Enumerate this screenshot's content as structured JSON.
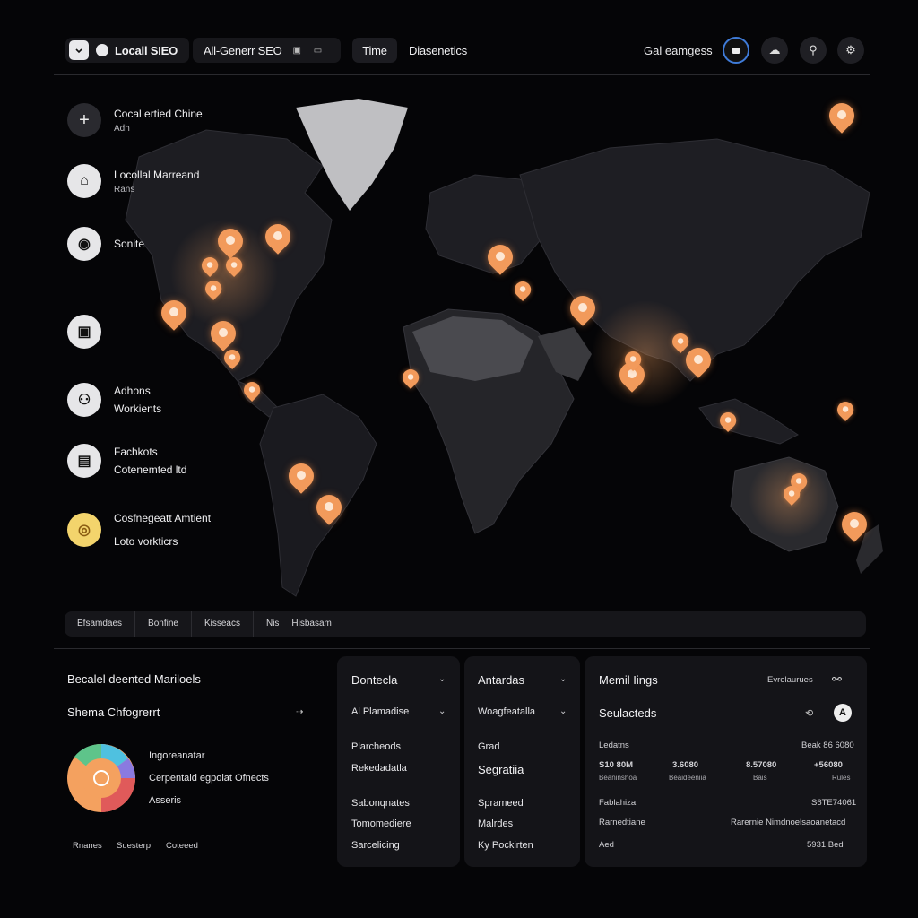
{
  "header": {
    "app_title": "Locall SIEO",
    "tab_seo": "All-Generr SEO",
    "tab_time": "Time",
    "tab_diagnostics": "Diasenetics",
    "user_label": "Gal eamgess"
  },
  "sidebar": {
    "items": [
      {
        "title": "Cocal ertied Chine",
        "sub": "Adh"
      },
      {
        "title": "Locollal Marreand",
        "sub": "Rans"
      },
      {
        "title": "Sonite",
        "sub": ""
      },
      {
        "title": "",
        "sub": ""
      },
      {
        "title": "Adhons",
        "sub": "Workients"
      },
      {
        "title": "Fachkots",
        "sub": "Cotenemted ltd"
      },
      {
        "title": "Cosfnegeatt Amtient",
        "sub": "Loto vorkticrs"
      }
    ]
  },
  "filter_strip": [
    "Efsamdaes",
    "Bonfine",
    "Kisseacs",
    "Nis",
    "Hisbasam"
  ],
  "panel_left": {
    "title": "Becalel deented Mariloels",
    "subtitle": "Shema Chfogrerrt",
    "legend": [
      "Ingoreanatar",
      "Cerpentald egpolat Ofnects",
      "Asseris"
    ],
    "footer": [
      "Rnanes",
      "Suesterp",
      "Coteeed"
    ],
    "donut_colors": [
      "#f4a15f",
      "#e05a5a",
      "#4fc1e0",
      "#5ec48a",
      "#8a7ae0"
    ]
  },
  "panel_mid1": {
    "title": "Dontecla",
    "select": "Al Plamadise",
    "rows": [
      "Plarcheods",
      "Rekedadatla",
      "Sabonqnates",
      "Tomomediere",
      "Sarcelicing"
    ]
  },
  "panel_mid2": {
    "title": "Antardas",
    "select": "Woagfeatalla",
    "rows": [
      "Grad",
      "Segratiia",
      "Sprameed",
      "Malrdes",
      "Ky Pockirten"
    ]
  },
  "panel_right": {
    "title": "Memil Iings",
    "top_right": "Evrelaurues",
    "subtitle": "Seulacteds",
    "r1_label": "Ledatns",
    "r1_value": "Beak 86 6080",
    "r2": [
      "S10 80M",
      "3.6080",
      "8.57080",
      "+56080"
    ],
    "r2_sub": [
      "Beaninshoa",
      "Beaideeniia",
      "Bais",
      "Rules"
    ],
    "r3_label": "Fablahiza",
    "r3_value": "S6TE74061",
    "r4_label": "Rarnedtiane",
    "r4_value": "Rarernie Nimdnoelsaoanetacd",
    "r5_label": "Aed",
    "r5_value": "5931 Bed"
  },
  "colors": {
    "accent": "#f29a5b",
    "bg": "#050507",
    "panel": "#141418"
  }
}
